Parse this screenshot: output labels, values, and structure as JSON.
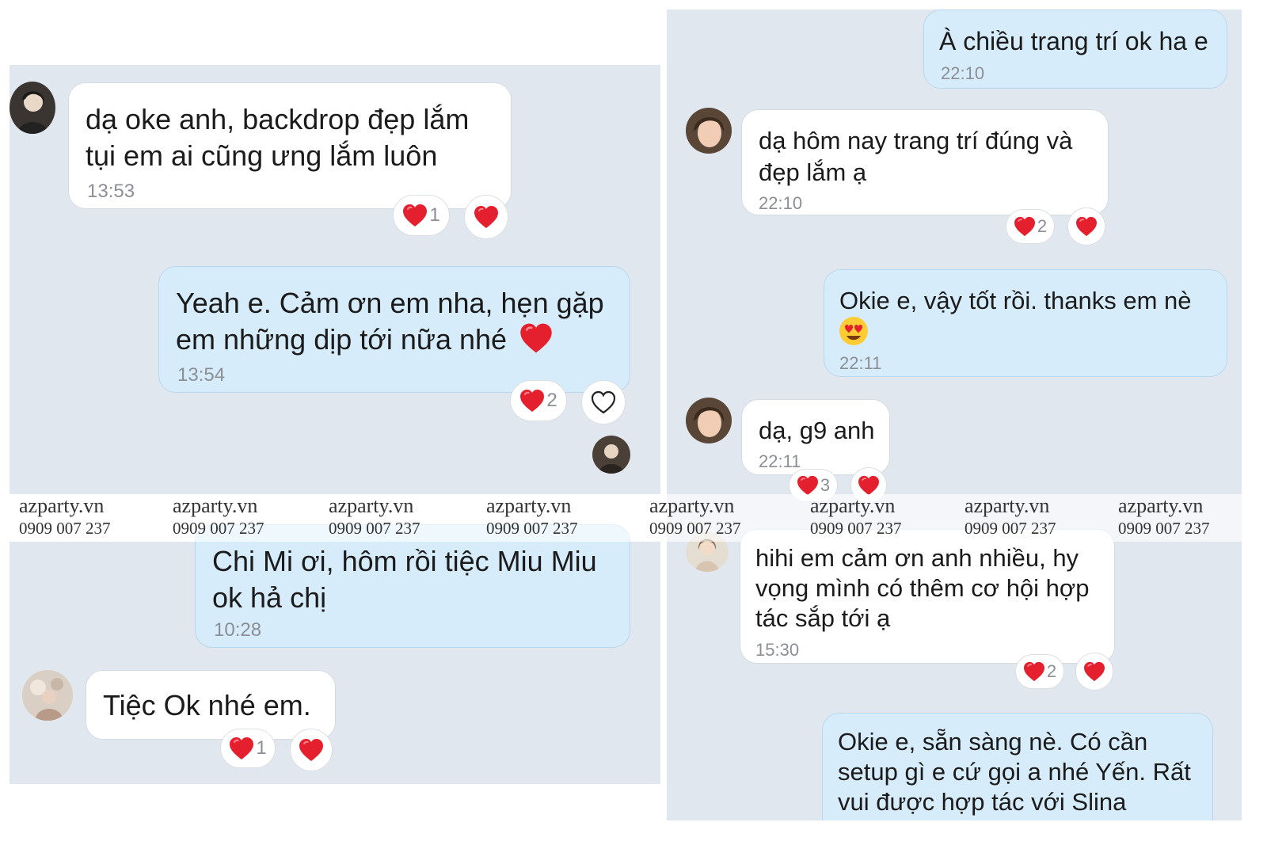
{
  "left_top": {
    "messages": [
      {
        "text": "dạ oke anh, backdrop đẹp lắm tụi em ai cũng ưng lắm luôn",
        "time": "13:53",
        "reaction_count": "1"
      },
      {
        "text": "Yeah e. Cảm ơn em nha, hẹn gặp em những dịp tới nữa nhé",
        "time": "13:54",
        "reaction_count": "2"
      }
    ]
  },
  "left_bottom": {
    "messages": [
      {
        "text": "Chi Mi ơi, hôm rồi tiệc Miu Miu ok hả chị",
        "time": "10:28"
      },
      {
        "text": "Tiệc Ok nhé em.",
        "reaction_count": "1"
      }
    ]
  },
  "right": {
    "messages": [
      {
        "text": "À chiều trang trí ok ha e",
        "time": "22:10"
      },
      {
        "text": "dạ hôm nay trang trí đúng và đẹp lắm ạ",
        "time": "22:10",
        "reaction_count": "2"
      },
      {
        "text": "Okie e, vậy tốt rồi. thanks em nè",
        "time": "22:11"
      },
      {
        "text": "dạ, g9 anh",
        "time": "22:11",
        "reaction_count": "3"
      },
      {
        "text": "hihi em cảm ơn anh nhiều, hy vọng mình có thêm cơ hội hợp tác sắp tới ạ",
        "time": "15:30",
        "reaction_count": "2"
      },
      {
        "text": "Okie e, sẵn sàng nè. Có cần setup gì e cứ gọi a nhé Yến. Rất vui được hợp tác với Slina"
      }
    ]
  },
  "watermark": {
    "site": "azparty.vn",
    "phone": "0909 007 237"
  },
  "colors": {
    "panel": "#e1e7ef",
    "incoming_bubble": "#ffffff",
    "outgoing_bubble": "#d6ecfa",
    "heart": "#e5202e"
  },
  "icons": [
    "heart-icon",
    "heart-outline-icon",
    "heart-eyes-emoji",
    "avatar"
  ]
}
